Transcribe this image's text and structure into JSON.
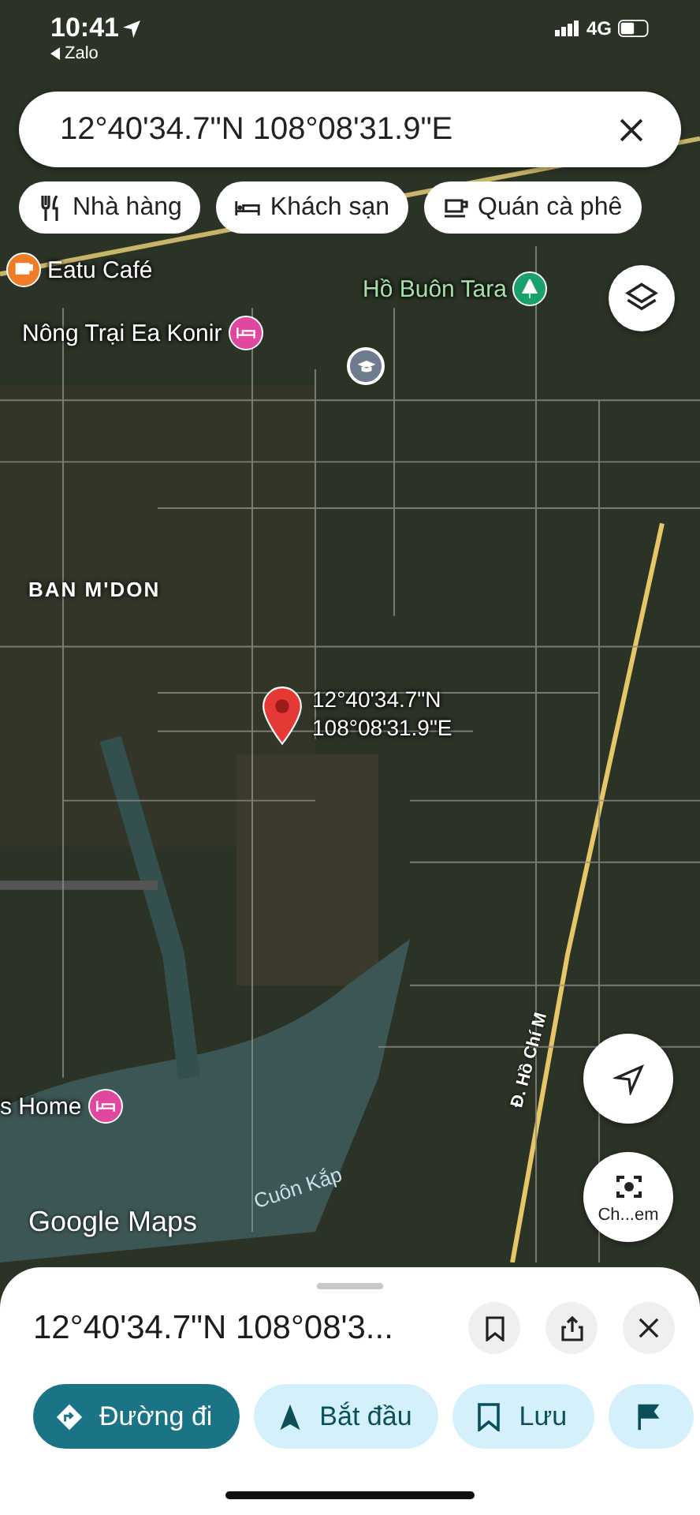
{
  "status_bar": {
    "time": "10:41",
    "back_app": "Zalo",
    "network": "4G"
  },
  "search": {
    "value": "12°40'34.7\"N 108°08'31.9\"E"
  },
  "chips": [
    {
      "label": "Nhà hàng",
      "kind": "restaurant"
    },
    {
      "label": "Khách sạn",
      "kind": "hotel"
    },
    {
      "label": "Quán cà phê",
      "kind": "cafe"
    }
  ],
  "map": {
    "labels": [
      {
        "text": "Eatu Café",
        "kind": "cafe"
      },
      {
        "text": "Hồ Buôn Tara",
        "kind": "park"
      },
      {
        "text": "Nông Trại Ea Konir",
        "kind": "hotel"
      },
      {
        "text": "BAN M'DON",
        "kind": "area"
      },
      {
        "text": "s Home",
        "kind": "hotel"
      },
      {
        "text": "Cuôn Kắp",
        "kind": "water"
      },
      {
        "text": "Đ. Hồ Chí M",
        "kind": "road"
      }
    ],
    "pin": {
      "lines": [
        "12°40'34.7\"N",
        "108°08'31.9\"E"
      ]
    },
    "logo": "Google Maps",
    "lens_label": "Ch...em"
  },
  "sheet": {
    "title": "12°40'34.7\"N 108°08'3...",
    "actions": [
      {
        "label": "Đường đi",
        "kind": "directions",
        "selected": true
      },
      {
        "label": "Bắt đầu",
        "kind": "start",
        "selected": false
      },
      {
        "label": "Lưu",
        "kind": "save",
        "selected": false
      },
      {
        "kind": "flag",
        "selected": false
      }
    ]
  }
}
